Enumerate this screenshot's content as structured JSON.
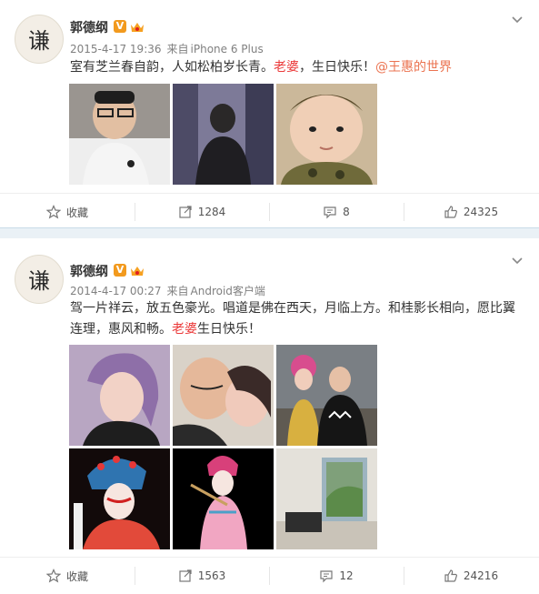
{
  "posts": [
    {
      "author": "郭德纲",
      "verified": "V",
      "time": "2015-4-17 19:36",
      "source_prefix": "来自",
      "source": "iPhone 6 Plus",
      "text_a": "室有芝兰春自韵，人如松柏岁长青。",
      "text_red": "老婆",
      "text_b": "，生日快乐！",
      "mention": "@王惠的世界",
      "actions": {
        "favorite": "收藏",
        "repost": "1284",
        "comment": "8",
        "like": "24325"
      }
    },
    {
      "author": "郭德纲",
      "verified": "V",
      "time": "2014-4-17 00:27",
      "source_prefix": "来自",
      "source": "Android客户端",
      "text_line1": "驾一片祥云，放五色豪光。唱道是佛在西天，月临上方。和桂影长相向，愿比翼",
      "text_line2_a": "连理，惠风和畅。",
      "text_red": "老婆",
      "text_line2_b": "生日快乐！",
      "actions": {
        "favorite": "收藏",
        "repost": "1563",
        "comment": "12",
        "like": "24216"
      }
    }
  ],
  "colors": {
    "verified_badge": "#f29a1e",
    "highlight_red": "#eb3a3a",
    "mention": "#eb7350",
    "separator": "#eaf1f6"
  }
}
